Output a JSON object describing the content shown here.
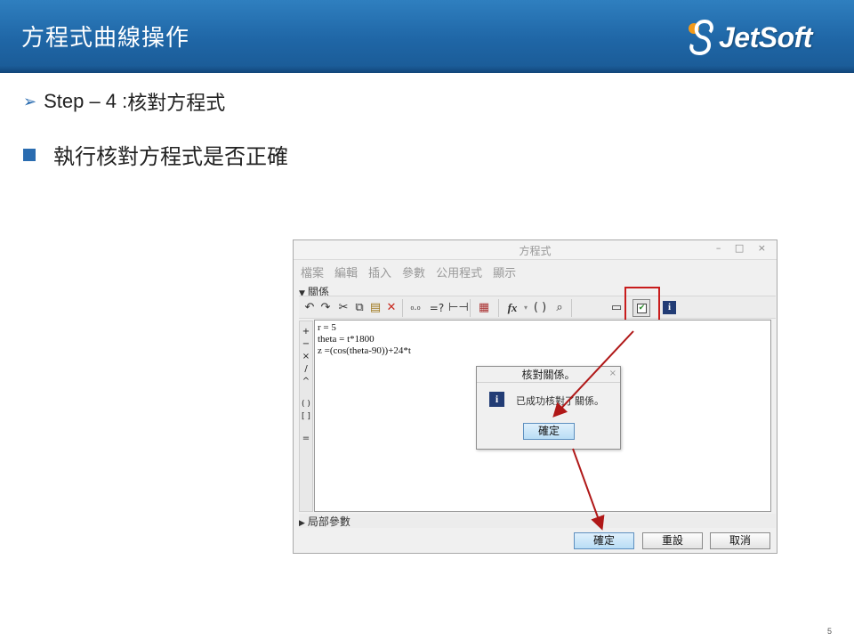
{
  "slide": {
    "title": "方程式曲線操作",
    "logo_text": "JetSoft",
    "bullet1_prefix": "Step – 4 : ",
    "bullet1_text": "核對方程式",
    "bullet2_text": "執行核對方程式是否正確",
    "page_number": "5"
  },
  "window": {
    "title": "方程式",
    "controls": "– □ ×",
    "menu": [
      "檔案",
      "編輯",
      "插入",
      "參數",
      "公用程式",
      "顯示"
    ],
    "relations_header": "關係",
    "equations": [
      "r = 5",
      "theta = t*1800",
      "z =(cos(theta-90))+24*t"
    ],
    "palette": [
      "+",
      "−",
      "×",
      "/",
      "^",
      "( )",
      "[ ]",
      "="
    ],
    "local_params_header": "局部參數",
    "buttons": {
      "ok": "確定",
      "reset": "重設",
      "cancel": "取消"
    },
    "toolbar": {
      "eval_label": "=?",
      "fx_label": "fx"
    }
  },
  "popup": {
    "title": "核對關係。",
    "close": "×",
    "message": "已成功核對了關係。",
    "ok": "確定"
  },
  "colors": {
    "header_blue": "#1f66a6",
    "bullet_blue": "#2a6cb0",
    "highlight_red": "#c81c1c",
    "info_icon": "#223c75"
  }
}
